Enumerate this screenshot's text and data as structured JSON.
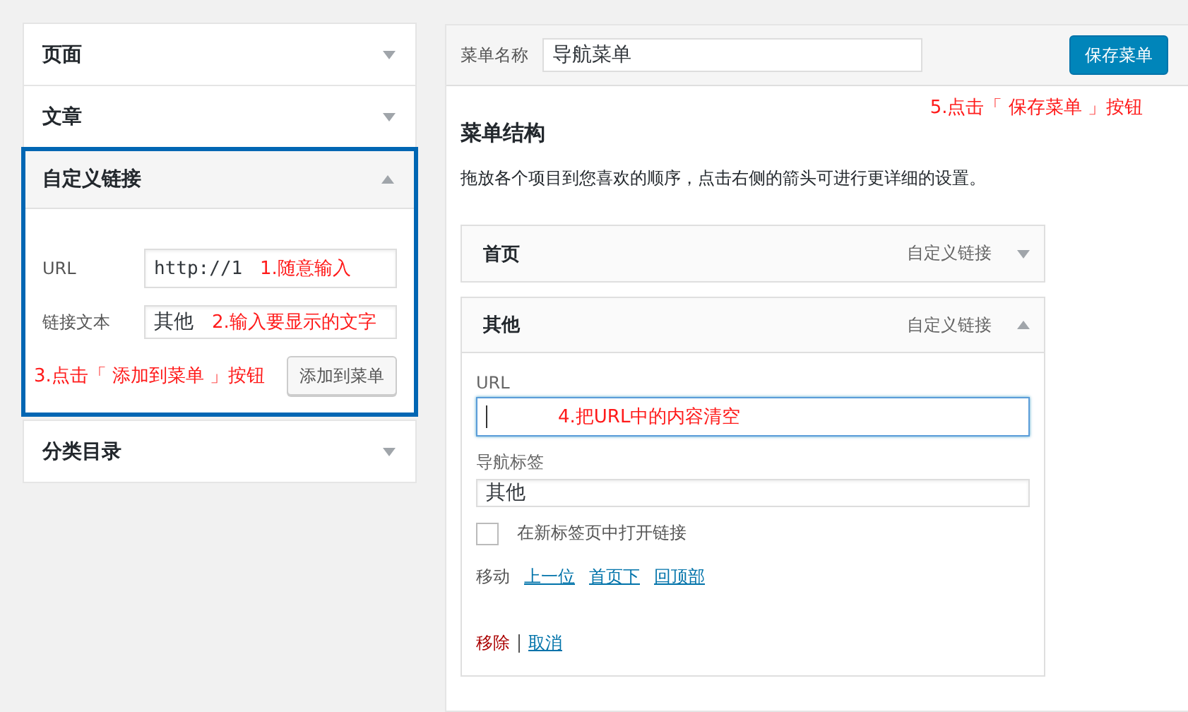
{
  "left_panel": {
    "sections": [
      {
        "title": "页面",
        "expanded": false,
        "highlighted": false
      },
      {
        "title": "文章",
        "expanded": false,
        "highlighted": false
      },
      {
        "title": "自定义链接",
        "expanded": true,
        "highlighted": true,
        "fields": [
          {
            "label": "URL",
            "value": "http://1",
            "annotation": "1.随意输入",
            "kind": "mono"
          },
          {
            "label": "链接文本",
            "value": "其他",
            "annotation": "2.输入要显示的文字",
            "kind": "text"
          }
        ],
        "annotation": "3.点击「 添加到菜单 」按钮",
        "button": "添加到菜单"
      },
      {
        "title": "分类目录",
        "expanded": false,
        "highlighted": false
      }
    ]
  },
  "menu_panel": {
    "name_label": "菜单名称",
    "name_value": "导航菜单",
    "save_button": "保存菜单",
    "annotation": "5.点击「 保存菜单 」按钮",
    "heading": "菜单结构",
    "description": "拖放各个项目到您喜欢的顺序，点击右侧的箭头可进行更详细的设置。",
    "items": [
      {
        "title": "首页",
        "type": "自定义链接",
        "expanded": false
      },
      {
        "title": "其他",
        "type": "自定义链接",
        "expanded": true,
        "details": {
          "url_label": "URL",
          "url_focused": true,
          "url_annotation": "4.把URL中的内容清空",
          "nav_label": "导航标签",
          "nav_value": "其他",
          "new_tab_label": "在新标签页中打开链接",
          "new_tab_checked": false,
          "move_label": "移动",
          "move_links": [
            "上一位",
            "首页下",
            "回顶部"
          ],
          "remove": "移除",
          "cancel": "取消"
        }
      }
    ]
  }
}
